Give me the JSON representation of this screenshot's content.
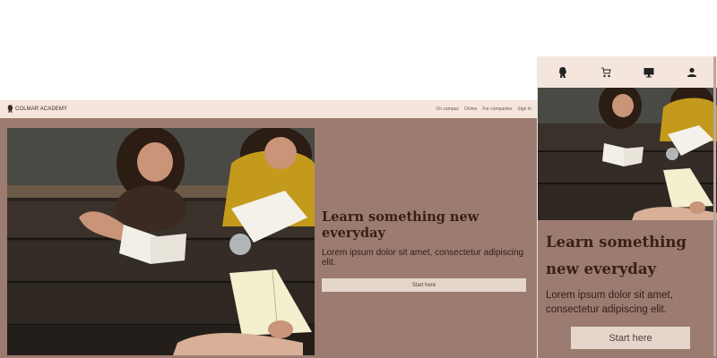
{
  "brand": {
    "name": "COLMAR ACADEMY",
    "logo_icon": "lion-icon"
  },
  "desktop_nav": {
    "links": [
      "On campus",
      "Online",
      "For companies",
      "Sign In"
    ]
  },
  "hero": {
    "title": "Learn something new everyday",
    "body": "Lorem ipsum dolor sit amet, consectetur adipiscing elit.",
    "cta": "Start here",
    "image": "students-reading-at-picnic-table-photo"
  },
  "mobile_nav": {
    "icons": [
      "lion-icon",
      "stroller-icon",
      "monitor-icon",
      "user-icon"
    ]
  },
  "colors": {
    "nav_bg": "#f4e6dc",
    "page_bg": "#9c7b70",
    "button_bg": "#e5d5ca",
    "title": "#3b1f14"
  }
}
